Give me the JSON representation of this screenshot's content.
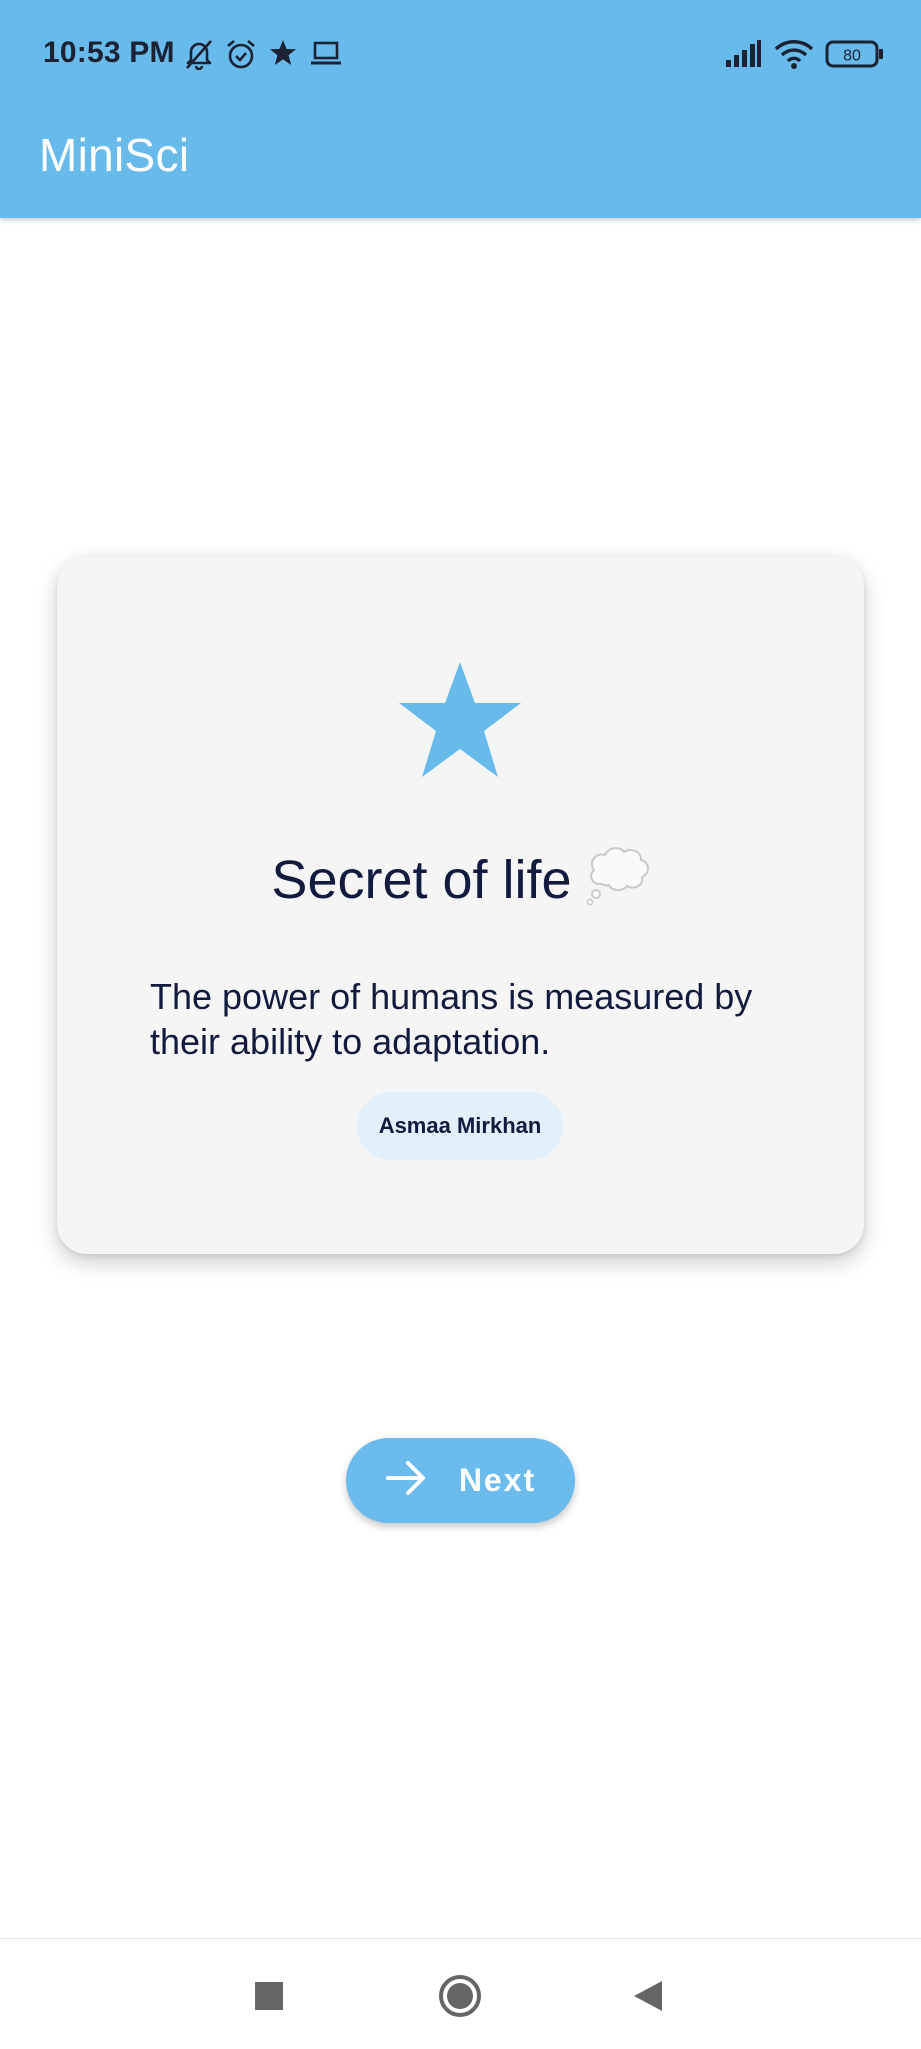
{
  "status_bar": {
    "time": "10:53 PM",
    "left_icons": [
      "notifications-off-icon",
      "alarm-icon",
      "star-icon",
      "laptop-icon"
    ],
    "right_icons": [
      "signal-icon",
      "wifi-icon",
      "battery-icon"
    ],
    "battery_level": "80"
  },
  "app_bar": {
    "title": "MiniSci"
  },
  "card": {
    "icon": "star-icon",
    "title": "Secret of life",
    "title_emoji": "thought-balloon-icon",
    "quote": "The power of humans is measured by their ability to adaptation.",
    "author": "Asmaa Mirkhan"
  },
  "next_button": {
    "label": "Next",
    "icon": "arrow-right-icon"
  },
  "nav_bar": {
    "buttons": [
      "recents-square-icon",
      "home-circle-icon",
      "back-triangle-icon"
    ]
  },
  "colors": {
    "primary": "#68baeb",
    "card_background": "#f5f5f6",
    "chip_background": "#e2f0fb",
    "text_dark": "#121a3e"
  }
}
